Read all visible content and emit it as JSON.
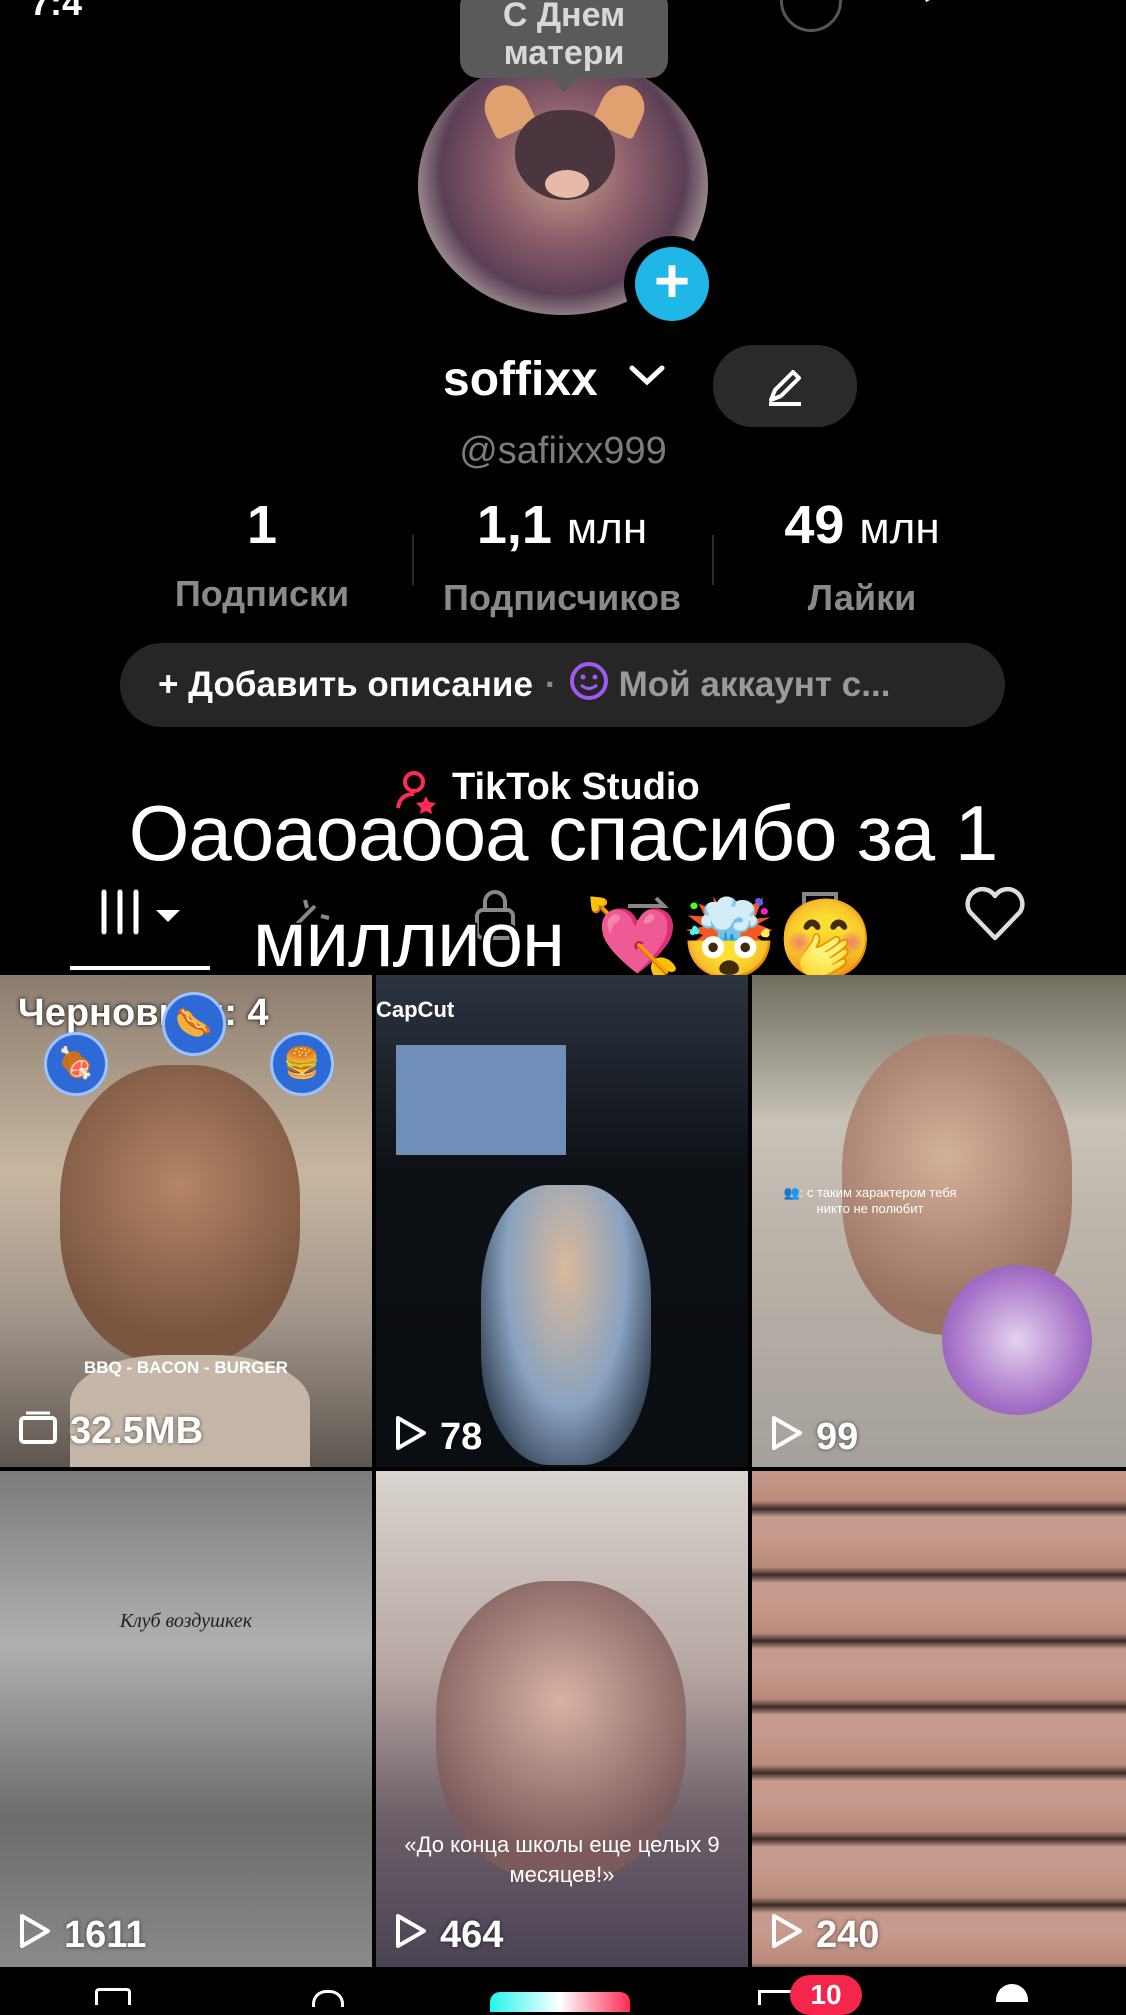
{
  "avatar": {
    "tooltip": "С Днем\nматери"
  },
  "profile": {
    "display_name": "soffixx",
    "handle": "@safiixx999",
    "stats": [
      {
        "num": "1",
        "unit": "",
        "label": "Подписки"
      },
      {
        "num": "1,1",
        "unit": "млн",
        "label": "Подписчиков"
      },
      {
        "num": "49",
        "unit": "млн",
        "label": "Лайки"
      }
    ],
    "bio_add": "+ Добавить описание",
    "bio_separator": "·",
    "bio_account": "Мой аккаунт с..."
  },
  "studio_label": "TikTok Studio",
  "overlay_caption": "Оаоаоаооа спасибо за 1 миллион 💘🤯🤭",
  "grid": {
    "drafts_label": "Черновики: 4",
    "drafts_size": "32.5MB",
    "draft_filter_text": "BBQ - BACON - BURGER",
    "capcut_label": "CapCut",
    "tile3_caption": "👥: с таким характером тебя никто не полюбит",
    "tile4_caption": "Клуб воздушкек",
    "tile5_caption": "«До конца школы еще целых 9 месяцев!»",
    "views": [
      "78",
      "99",
      "1611",
      "464",
      "240"
    ]
  },
  "nav": {
    "inbox_badge": "10"
  },
  "colors": {
    "accent_blue": "#1fb6e8",
    "badge_red": "#f5264c",
    "pill_bg": "#262626"
  }
}
